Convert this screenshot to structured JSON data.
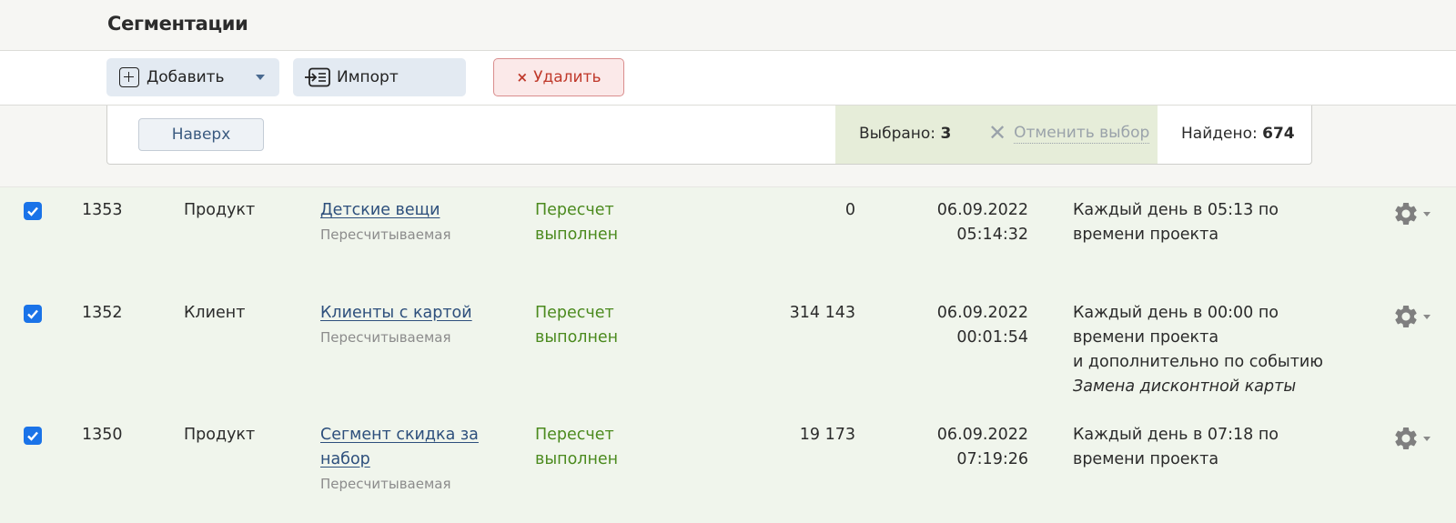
{
  "header": {
    "title": "Сегментации"
  },
  "toolbar": {
    "add_label": "Добавить",
    "import_label": "Импорт",
    "delete_label": "Удалить"
  },
  "selection": {
    "top_button": "Наверх",
    "selected_label": "Выбрано:",
    "selected_count": "3",
    "cancel_label": "Отменить выбор",
    "found_label": "Найдено:",
    "found_count": "674"
  },
  "rows": [
    {
      "checked": true,
      "id": "1353",
      "type": "Продукт",
      "name": "Детские вещи",
      "kind": "Пересчитываемая",
      "status": "Пересчет выполнен",
      "count": "0",
      "date": "06.09.2022",
      "time": "05:14:32",
      "schedule": [
        "Каждый день в 05:13 по",
        "времени проекта"
      ],
      "schedule_event": ""
    },
    {
      "checked": true,
      "id": "1352",
      "type": "Клиент",
      "name": "Клиенты с картой",
      "kind": "Пересчитываемая",
      "status": "Пересчет выполнен",
      "count": "314 143",
      "date": "06.09.2022",
      "time": "00:01:54",
      "schedule": [
        "Каждый день в 00:00 по",
        "времени проекта",
        "и дополнительно по событию"
      ],
      "schedule_event": "Замена дисконтной карты"
    },
    {
      "checked": true,
      "id": "1350",
      "type": "Продукт",
      "name": "Сегмент скидка за набор",
      "kind": "Пересчитываемая",
      "status": "Пересчет выполнен",
      "count": "19 173",
      "date": "06.09.2022",
      "time": "07:19:26",
      "schedule": [
        "Каждый день в 07:18 по",
        "времени проекта"
      ],
      "schedule_event": ""
    }
  ],
  "colors": {
    "accent_link": "#2d4f7c",
    "status_green": "#4b8a1e",
    "row_bg": "#f0f5ec",
    "selected_bg": "#e6edd9",
    "delete_red": "#c0392b"
  },
  "icons": [
    "plus-box-icon",
    "chevron-down-icon",
    "import-icon",
    "close-icon",
    "gear-icon",
    "checkbox-checked-icon"
  ]
}
